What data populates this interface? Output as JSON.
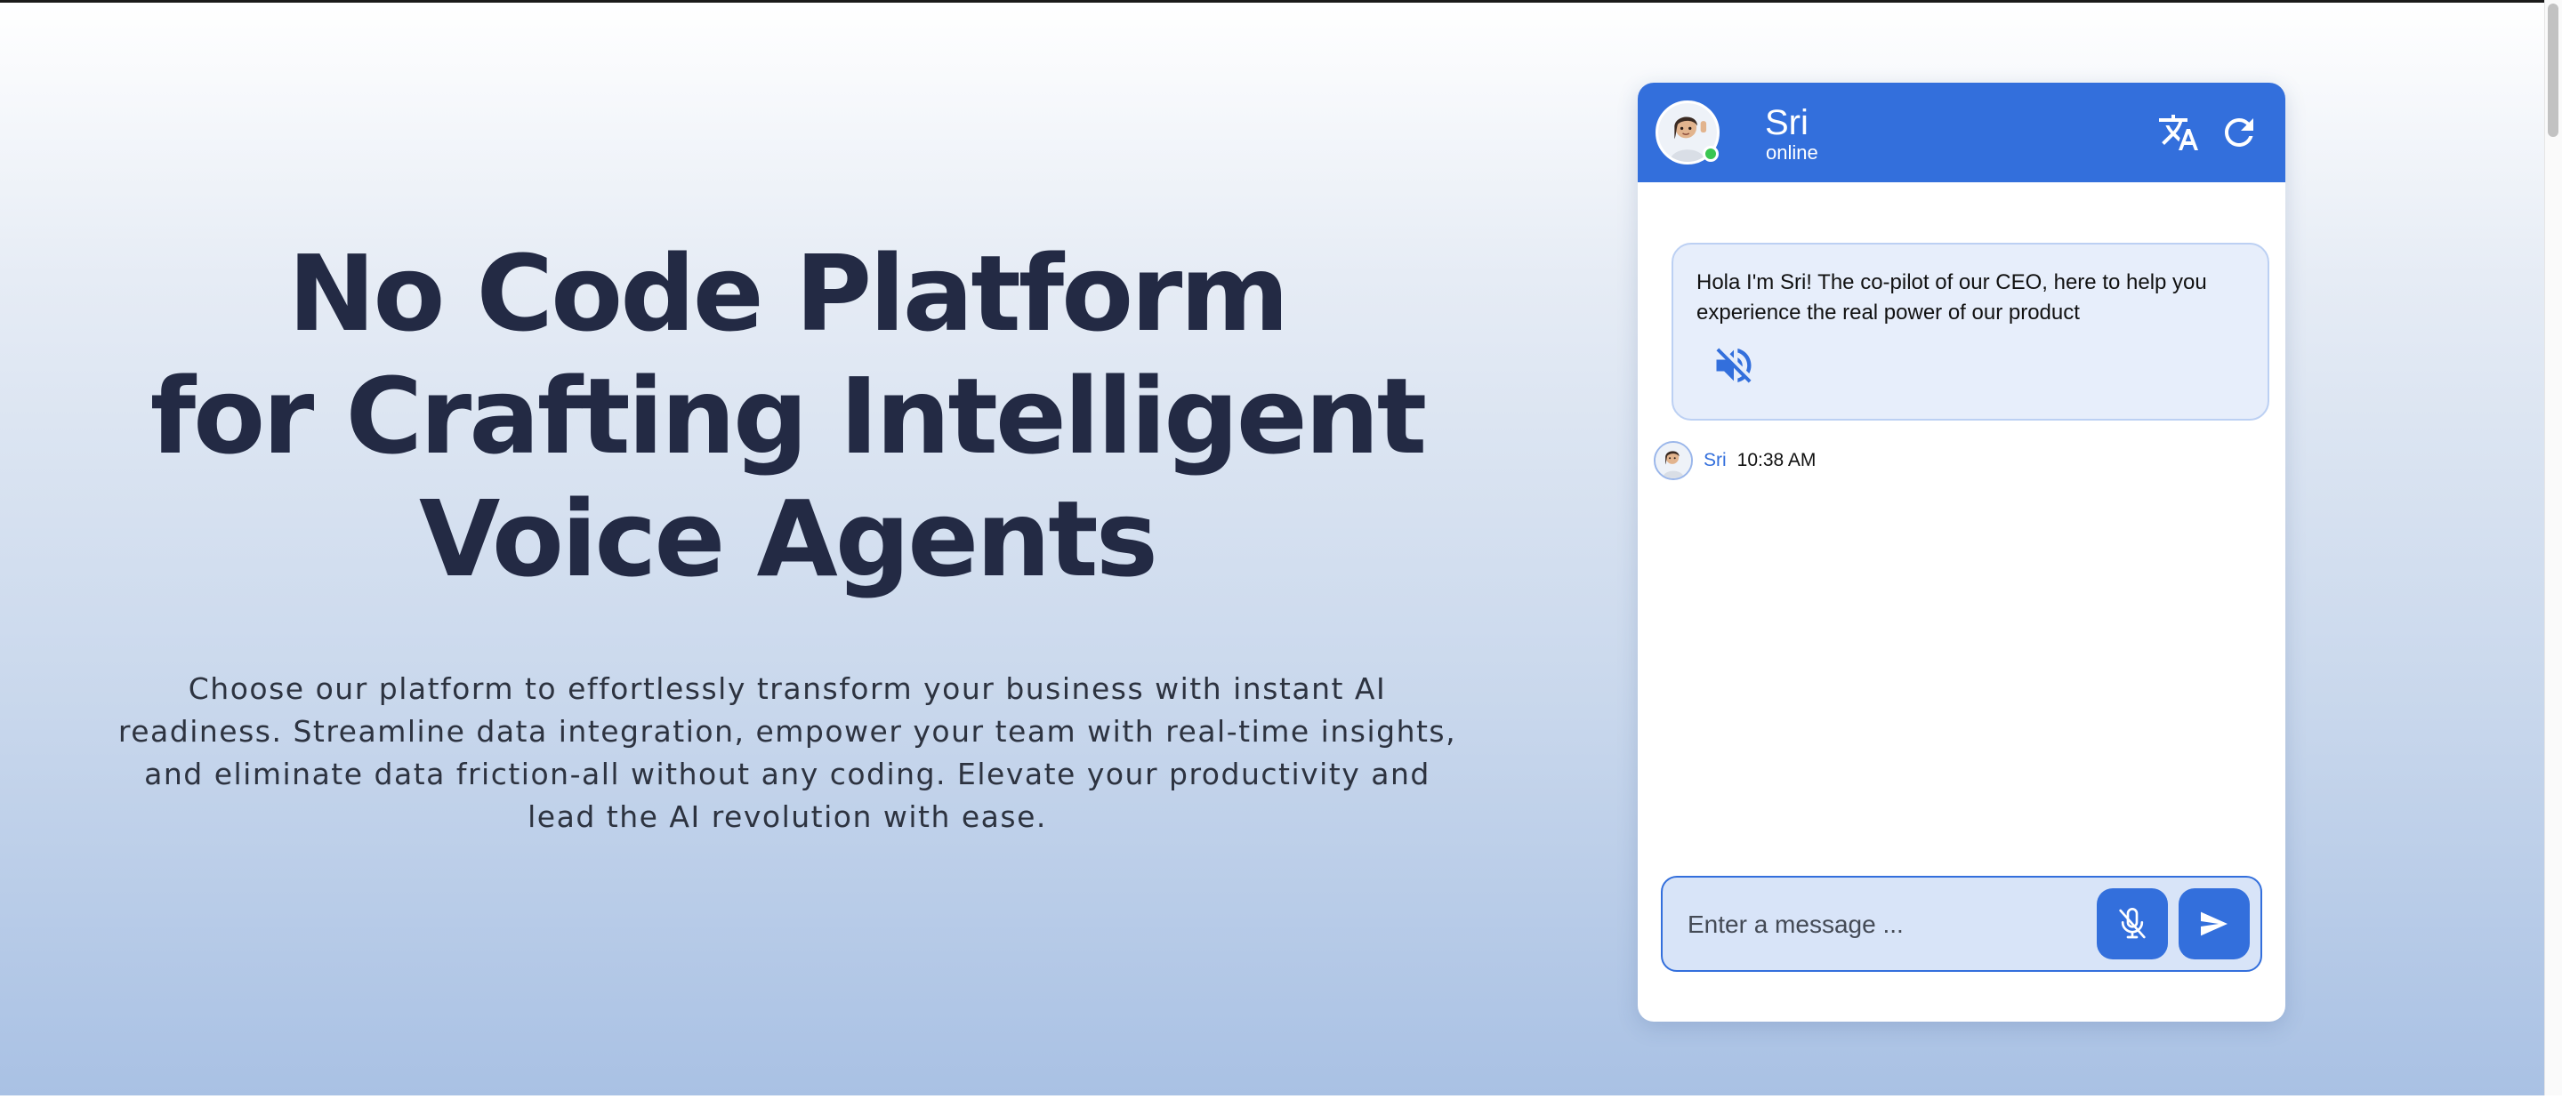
{
  "hero": {
    "headline": [
      "No Code Platform",
      "for Crafting Intelligent",
      "Voice Agents"
    ],
    "subcopy": "Choose our platform to effortlessly transform your business with instant AI readiness. Streamline data integration, empower your team with real-time insights, and eliminate data friction-all without any coding. Elevate your productivity and lead the AI revolution with ease."
  },
  "chat": {
    "header": {
      "agent_name": "Sri",
      "status": "online",
      "avatar_icon": "agent-avatar-icon",
      "translate_icon": "translate-icon",
      "refresh_icon": "refresh-icon"
    },
    "messages": [
      {
        "text": "Hola I'm Sri! The co-pilot of our CEO, here to help you experience the real power of our product",
        "sender": "Sri",
        "time": "10:38 AM",
        "action_icon": "volume-mute-icon"
      }
    ],
    "composer": {
      "placeholder": "Enter a message ...",
      "mic_icon": "mic-off-icon",
      "send_icon": "send-icon"
    }
  },
  "colors": {
    "brand": "#336fdc",
    "headline": "#232a44",
    "online": "#3ac651",
    "bubble_bg": "#e7eefb"
  }
}
